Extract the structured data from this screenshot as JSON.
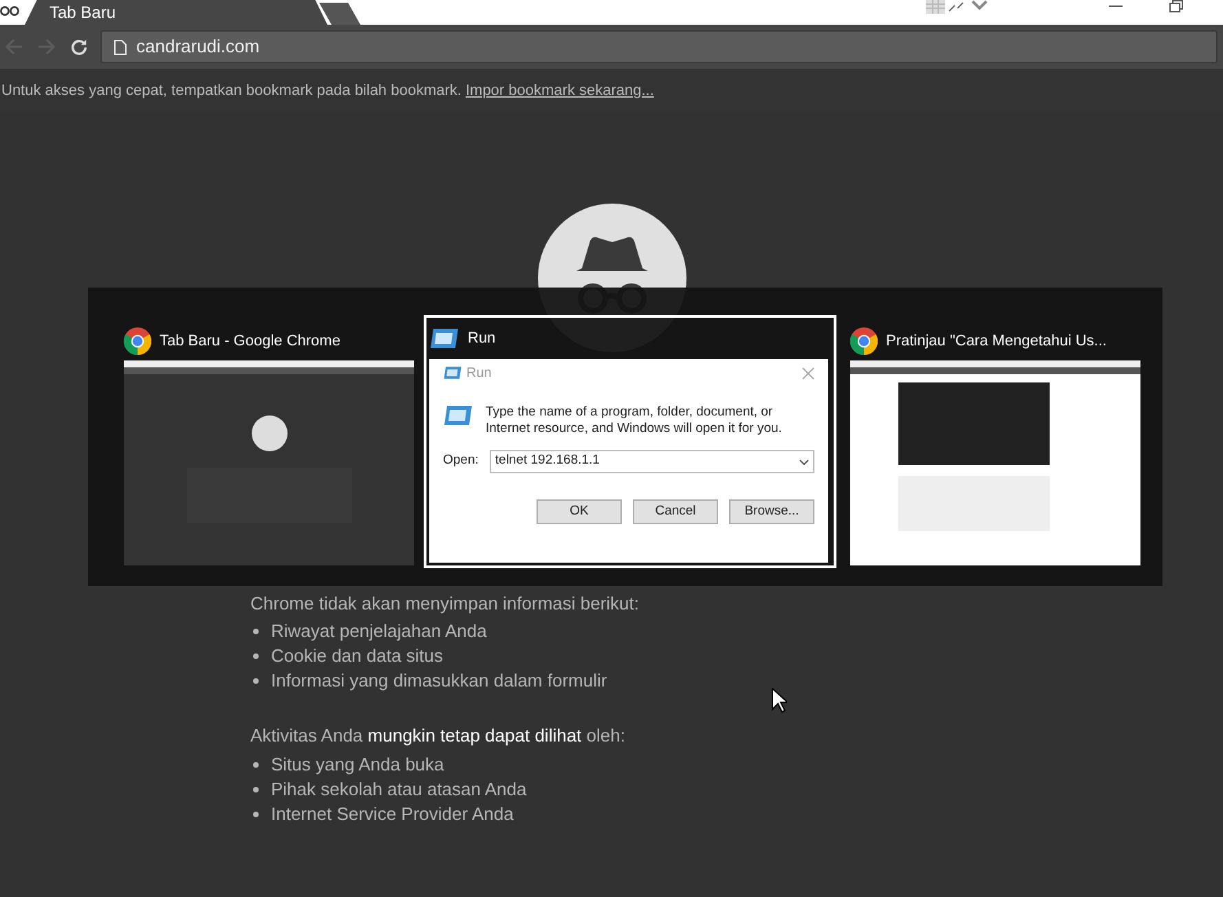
{
  "browser": {
    "tabs": [
      {
        "label": "Tab Baru",
        "selected": true
      }
    ],
    "address": "candrarudi.com"
  },
  "bookmark_bar": {
    "message": "Untuk akses yang cepat, tempatkan bookmark pada bilah bookmark.",
    "link": "Impor bookmark sekarang..."
  },
  "page": {
    "heading": "Chrome tidak akan menyimpan informasi berikut:",
    "not_saved": [
      "Riwayat penjelajahan Anda",
      "Cookie dan data situs",
      "Informasi yang dimasukkan dalam formulir"
    ],
    "visible_intro": "Aktivitas Anda **mungkin tetap dapat dilihat** oleh:",
    "visible_to": [
      "Situs yang Anda buka",
      "Pihak sekolah atau atasan Anda",
      "Internet Service Provider Anda"
    ]
  },
  "task_switcher": {
    "windows": [
      {
        "title": "Tab Baru - Google Chrome",
        "kind": "chrome",
        "selected": false
      },
      {
        "title": "Run",
        "kind": "run",
        "selected": true
      },
      {
        "title": "Pratinjau \"Cara Mengetahui Us...",
        "kind": "chrome",
        "selected": false
      }
    ]
  },
  "run_dialog": {
    "title": "Run",
    "message": "Type the name of a program, folder, document, or Internet resource, and Windows will open it for you.",
    "open_label": "Open:",
    "command": "telnet 192.168.1.1",
    "buttons": [
      "OK",
      "Cancel",
      "Browse..."
    ]
  }
}
